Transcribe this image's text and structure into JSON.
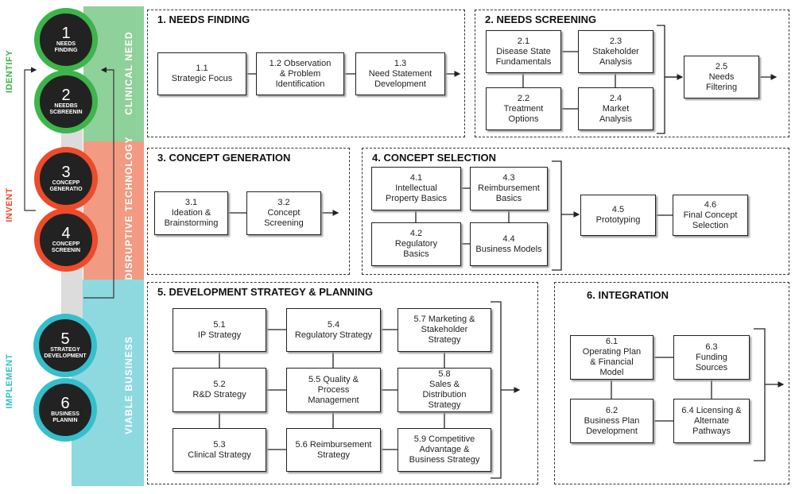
{
  "phases": {
    "identify": "IDENTIFY",
    "invent": "INVENT",
    "implement": "IMPLEMENT"
  },
  "bands": {
    "clinical": "CLINICAL NEED",
    "disruptive": "DISRUPTIVE TECHNOLOGY",
    "viable": "VIABLE BUSINESS"
  },
  "colors": {
    "green": "#3cb54a",
    "red": "#ee4b2b",
    "teal": "#35bfcc"
  },
  "circles": [
    {
      "num": "1",
      "label": "NEEDS\nFINDING"
    },
    {
      "num": "2",
      "label": "NEEDBS\nSCBREENIN"
    },
    {
      "num": "3",
      "label": "CONCEPP\nGENERATIO"
    },
    {
      "num": "4",
      "label": "CONCEPP\nSCREENIN"
    },
    {
      "num": "5",
      "label": "STRATEGY\nDEVELOPMENT"
    },
    {
      "num": "6",
      "label": "BUSINESS\nPLANNIN"
    }
  ],
  "panels": {
    "p1": {
      "title": "1. NEEDS FINDING",
      "boxes": [
        "1.1\nStrategic Focus",
        "1.2 Observation\n& Problem\nIdentification",
        "1.3\nNeed Statement\nDevelopment"
      ]
    },
    "p2": {
      "title": "2. NEEDS SCREENING",
      "boxes": [
        "2.1\nDisease State\nFundamentals",
        "2.2\nTreatment\nOptions",
        "2.3\nStakeholder\nAnalysis",
        "2.4\nMarket\nAnalysis",
        "2.5\nNeeds\nFiltering"
      ]
    },
    "p3": {
      "title": "3. CONCEPT GENERATION",
      "boxes": [
        "3.1\nIdeation &\nBrainstorming",
        "3.2\nConcept\nScreening"
      ]
    },
    "p4": {
      "title": "4. CONCEPT SELECTION",
      "boxes": [
        "4.1\nIntellectual\nProperty Basics",
        "4.2\nRegulatory\nBasics",
        "4.3\nReimbursement\nBasics",
        "4.4\nBusiness Models",
        "4.5\nPrototyping",
        "4.6\nFinal Concept\nSelection"
      ]
    },
    "p5": {
      "title": "5. DEVELOPMENT STRATEGY & PLANNING",
      "boxes": [
        "5.1\nIP Strategy",
        "5.2\nR&D Strategy",
        "5.3\nClinical Strategy",
        "5.4\nRegulatory Strategy",
        "5.5 Quality &\nProcess\nManagement",
        "5.6 Reimbursement\nStrategy",
        "5.7 Marketing &\nStakeholder\nStrategy",
        "5.8\nSales &\nDistribution\nStrategy",
        "5.9 Competitive\nAdvantage &\nBusiness Strategy"
      ]
    },
    "p6": {
      "title": "6. INTEGRATION",
      "boxes": [
        "6.1\nOperating Plan\n& Financial\nModel",
        "6.2\nBusiness Plan\nDevelopment",
        "6.3\nFunding\nSources",
        "6.4 Licensing &\nAlternate\nPathways"
      ]
    }
  }
}
